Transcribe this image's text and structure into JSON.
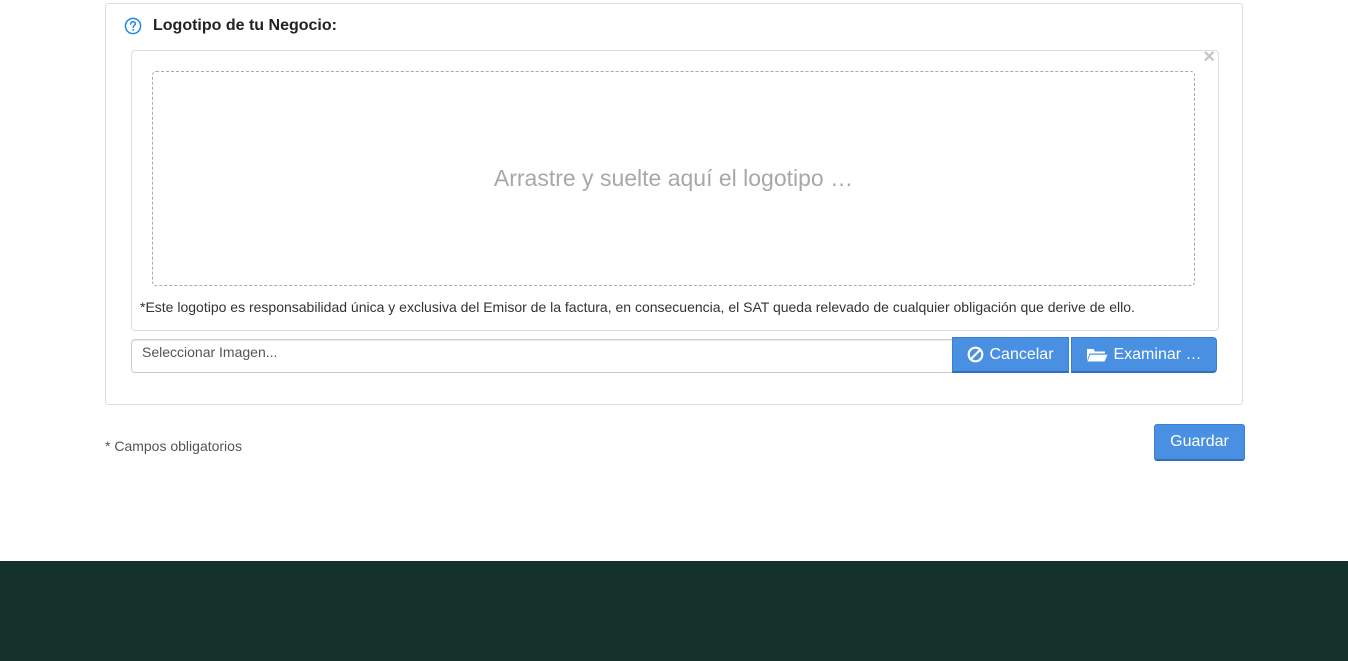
{
  "logo_section": {
    "title": "Logotipo de tu Negocio:",
    "help_icon": "question-circle-icon",
    "close_icon": "close-icon",
    "close_glyph": "×",
    "drop_zone_text": "Arrastre y suelte aquí el logotipo …",
    "disclaimer": "*Este logotipo es responsabilidad única y exclusiva del Emisor de la factura, en consecuencia, el SAT queda relevado de cualquier obligación que derive de ello.",
    "file_input": {
      "placeholder": "Seleccionar Imagen...",
      "value": ""
    },
    "cancel_button": {
      "label": "Cancelar",
      "icon": "ban-icon"
    },
    "browse_button": {
      "label": "Examinar …",
      "icon": "folder-open-icon"
    }
  },
  "form_footer": {
    "required_note": "* Campos obligatorios",
    "save_button": "Guardar"
  },
  "colors": {
    "primary": "#4a90e2",
    "footer_bg": "#14322b",
    "help_icon": "#1e88e5"
  }
}
